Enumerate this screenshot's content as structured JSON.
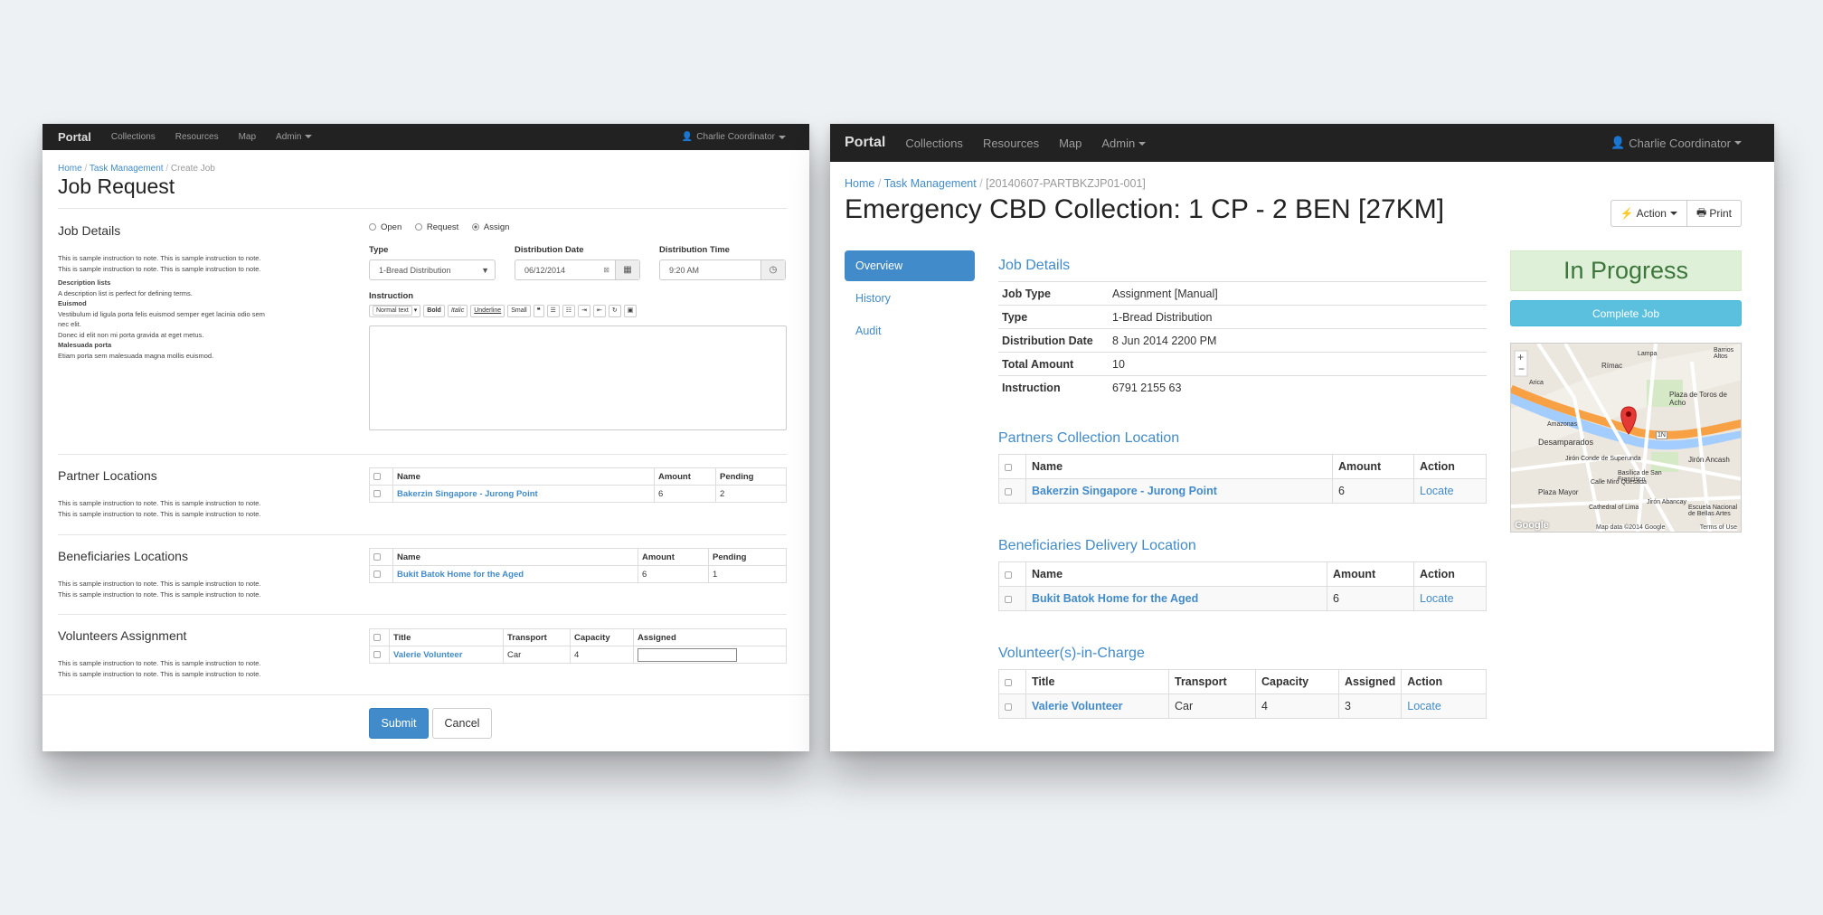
{
  "left": {
    "nav": {
      "brand": "Portal",
      "items": [
        "Collections",
        "Resources",
        "Map",
        "Admin"
      ],
      "user": "Charlie Coordinator"
    },
    "breadcrumb": {
      "home": "Home",
      "task": "Task Management",
      "current": "Create Job"
    },
    "title": "Job Request",
    "job_details": {
      "heading": "Job Details",
      "note1": "This is sample instruction to note. This is sample instruction to note.",
      "note2": "This is sample instruction to note. This is sample instruction to note.",
      "dl_title": "Description lists",
      "dl_text": "A description list is perfect for defining terms.",
      "t1": "Euismod",
      "t1_text1": "Vestibulum id ligula porta felis euismod semper eget lacinia odio sem",
      "t1_text2": "nec elit.",
      "t1_text3": "Donec id elit non mi porta gravida at eget metus.",
      "t2": "Malesuada porta",
      "t2_text": "Etiam porta sem malesuada magna mollis euismod."
    },
    "radios": {
      "open": "Open",
      "request": "Request",
      "assign": "Assign"
    },
    "type": {
      "label": "Type",
      "value": "1-Bread Distribution"
    },
    "dist_date": {
      "label": "Distribution Date",
      "value": "06/12/2014"
    },
    "dist_time": {
      "label": "Distribution Time",
      "value": "9:20 AM"
    },
    "instruction_label": "Instruction",
    "toolbar": {
      "normal": "Normal text",
      "bold": "Bold",
      "italic": "Italic",
      "underline": "Underline",
      "small": "Small"
    },
    "partner": {
      "heading": "Partner Locations",
      "note1": "This is sample instruction to note. This is sample instruction to note.",
      "note2": "This is sample instruction to note. This is sample instruction to note.",
      "cols": [
        "Name",
        "Amount",
        "Pending"
      ],
      "row": {
        "name": "Bakerzin Singapore - Jurong Point",
        "amount": "6",
        "pending": "2"
      }
    },
    "beneficiaries": {
      "heading": "Beneficiaries Locations",
      "note1": "This is sample instruction to note. This is sample instruction to note.",
      "note2": "This is sample instruction to note. This is sample instruction to note.",
      "cols": [
        "Name",
        "Amount",
        "Pending"
      ],
      "row": {
        "name": "Bukit Batok Home for the Aged",
        "amount": "6",
        "pending": "1"
      }
    },
    "volunteers": {
      "heading": "Volunteers Assignment",
      "note1": "This is sample instruction to note. This is sample instruction to note.",
      "note2": "This is sample instruction to note. This is sample instruction to note.",
      "cols": [
        "Title",
        "Transport",
        "Capacity",
        "Assigned"
      ],
      "row": {
        "title": "Valerie Volunteer",
        "transport": "Car",
        "capacity": "4"
      }
    },
    "submit": "Submit",
    "cancel": "Cancel"
  },
  "right": {
    "nav": {
      "brand": "Portal",
      "items": [
        "Collections",
        "Resources",
        "Map",
        "Admin"
      ],
      "user": "Charlie Coordinator"
    },
    "breadcrumb": {
      "home": "Home",
      "task": "Task Management",
      "current": "[20140607-PARTBKZJP01-001]"
    },
    "title": "Emergency CBD Collection: 1 CP - 2 BEN [27KM]",
    "action": "Action",
    "print": "Print",
    "tabs": [
      "Overview",
      "History",
      "Audit"
    ],
    "job_details": {
      "heading": "Job Details",
      "rows": [
        {
          "k": "Job Type",
          "v": "Assignment [Manual]"
        },
        {
          "k": "Type",
          "v": "1-Bread Distribution"
        },
        {
          "k": "Distribution Date",
          "v": "8 Jun 2014 2200 PM"
        },
        {
          "k": "Total Amount",
          "v": "10"
        },
        {
          "k": "Instruction",
          "v": "6791 2155 63"
        }
      ]
    },
    "partners": {
      "heading": "Partners Collection Location",
      "cols": [
        "Name",
        "Amount",
        "Action"
      ],
      "row": {
        "name": "Bakerzin Singapore - Jurong Point",
        "amount": "6",
        "action": "Locate"
      }
    },
    "beneficiaries": {
      "heading": "Beneficiaries Delivery Location",
      "cols": [
        "Name",
        "Amount",
        "Action"
      ],
      "row": {
        "name": "Bukit Batok Home for the Aged",
        "amount": "6",
        "action": "Locate"
      }
    },
    "volunteers": {
      "heading": "Volunteer(s)-in-Charge",
      "cols": [
        "Title",
        "Transport",
        "Capacity",
        "Assigned",
        "Action"
      ],
      "row": {
        "title": "Valerie Volunteer",
        "transport": "Car",
        "capacity": "4",
        "assigned": "3",
        "action": "Locate"
      }
    },
    "status": "In Progress",
    "complete": "Complete Job",
    "map": {
      "labels": [
        "Desamparados",
        "Plaza de Toros de Acho",
        "Jirón Ancash",
        "Basílica de San Francisco",
        "Plaza Mayor",
        "Cathedral of Lima",
        "Escuela Nacional de Bellas Artes",
        "Jirón Abancay",
        "Barrios Altos",
        "1N",
        "Amazonas",
        "Jirón Conde de Superunda",
        "Calle Miró Quesada",
        "Lampa",
        "Rímac",
        "Arica"
      ],
      "attribution": "Map data ©2014 Google",
      "terms": "Terms of Use",
      "logo": "Google"
    },
    "colors": {
      "primary": "#428bca",
      "info": "#5bc0de",
      "success_bg": "#dff0d8",
      "success_text": "#3c763d",
      "nav": "#222222"
    }
  }
}
